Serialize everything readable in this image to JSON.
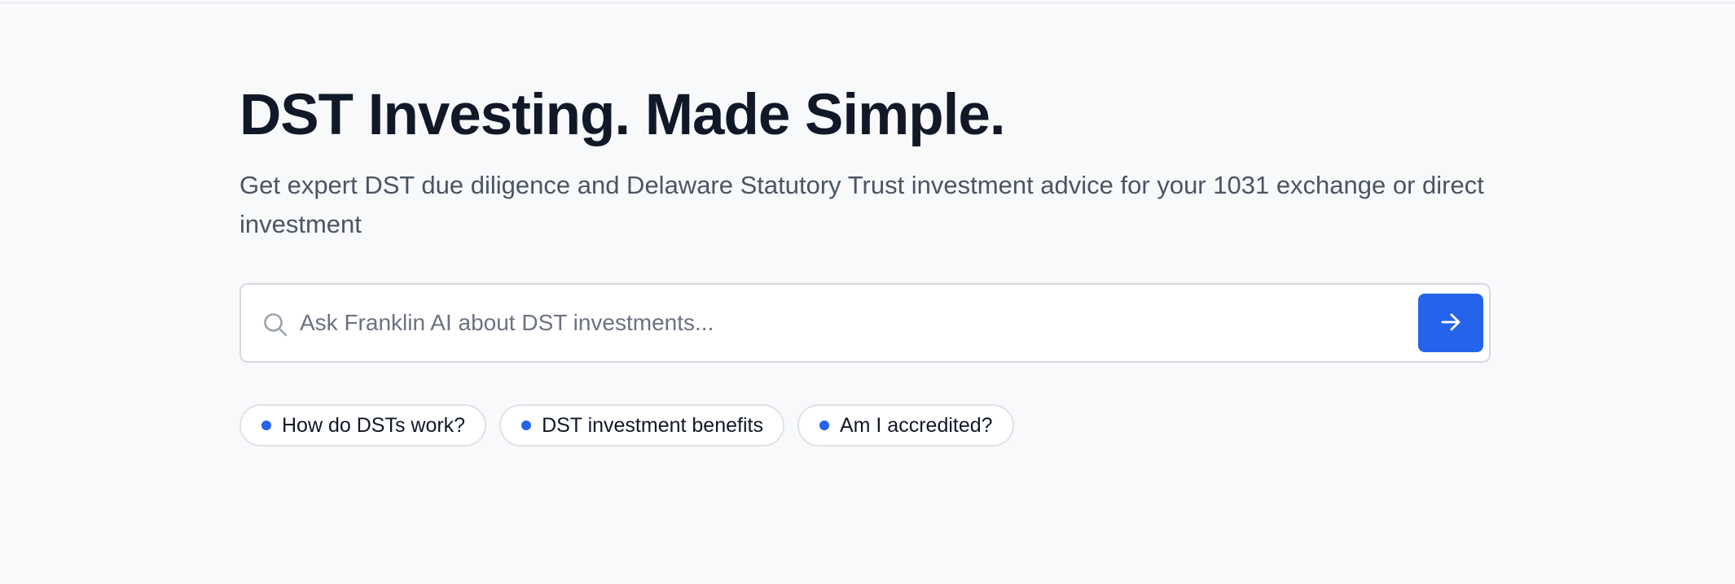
{
  "hero": {
    "title": "DST Investing. Made Simple.",
    "subtitle": "Get expert DST due diligence and Delaware Statutory Trust investment advice for your 1031 exchange or direct investment"
  },
  "search": {
    "placeholder": "Ask Franklin AI about DST investments...",
    "value": "",
    "icon": "search-icon",
    "submit_icon": "arrow-right-icon"
  },
  "suggestions": [
    {
      "label": "How do DSTs work?"
    },
    {
      "label": "DST investment benefits"
    },
    {
      "label": "Am I accredited?"
    }
  ],
  "colors": {
    "accent": "#2563eb",
    "background": "#f8f9fb",
    "heading": "#111827",
    "subtext": "#4b5563"
  }
}
